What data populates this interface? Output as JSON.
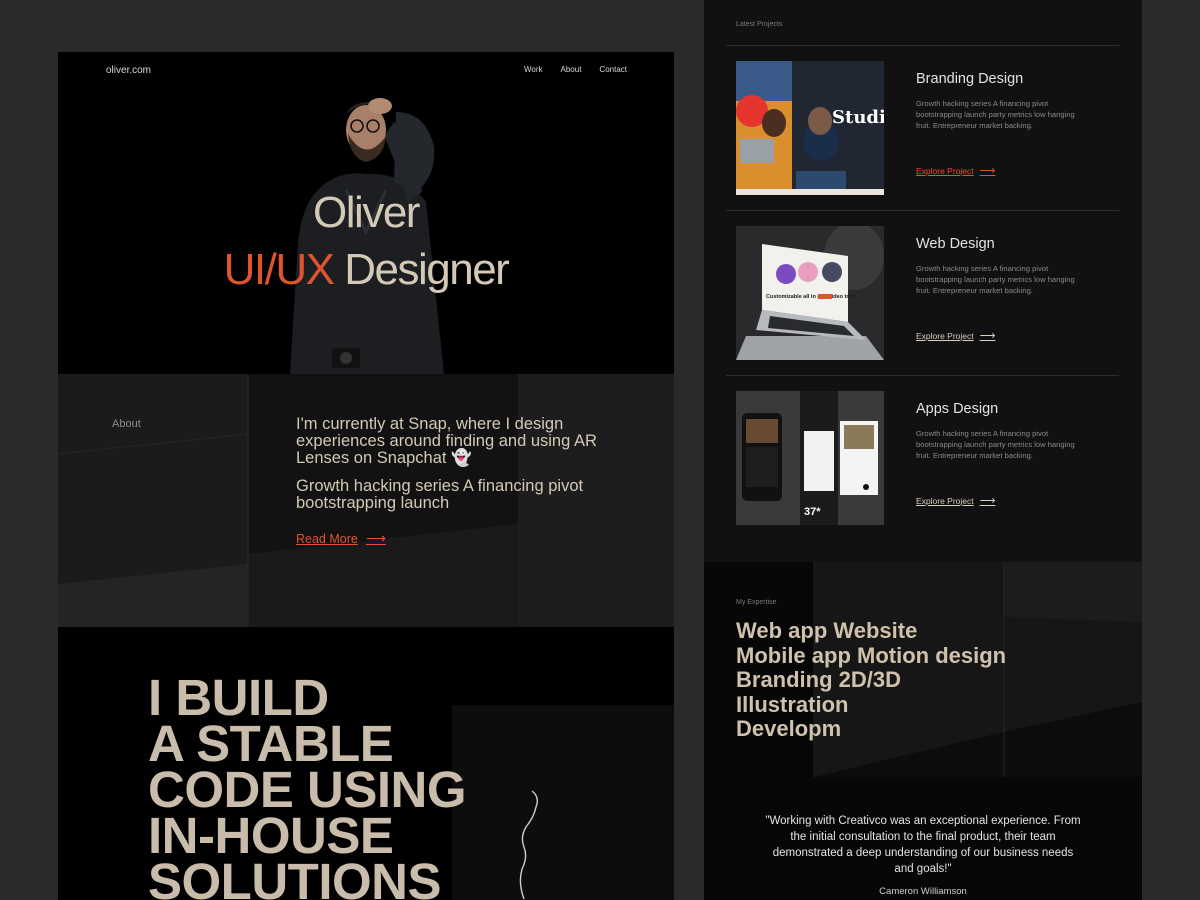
{
  "left": {
    "logo": "oliver.com",
    "nav": {
      "work": "Work",
      "about": "About",
      "contact": "Contact"
    },
    "hero": {
      "name": "Oliver",
      "role_accent": "UI/UX",
      "role_rest": " Designer"
    },
    "about": {
      "label": "About",
      "paragraph1": "I'm currently at Snap, where I design experiences around finding and using AR Lenses on Snapchat 👻",
      "paragraph2": "Growth hacking series A financing pivot bootstrapping launch",
      "read_more": "Read More"
    },
    "build": {
      "lines": [
        "I BUILD",
        "A STABLE",
        "CODE USING",
        "IN-HOUSE",
        "SOLUTIONS"
      ]
    }
  },
  "right": {
    "latest_label": "Latest Projects",
    "projects": [
      {
        "title": "Branding Design",
        "description": "Growth hacking series A financing pivot bootstrapping launch party metrics low hanging fruit. Entrepreneur market backing.",
        "link": "Explore Project"
      },
      {
        "title": "Web Design",
        "description": "Growth hacking series A financing pivot bootstrapping launch party metrics low hanging fruit. Entrepreneur market backing.",
        "link": "Explore Project"
      },
      {
        "title": "Apps Design",
        "description": "Growth hacking series A financing pivot bootstrapping launch party metrics low hanging fruit. Entrepreneur market backing.",
        "link": "Explore Project"
      }
    ],
    "thumb_text": {
      "studio": "Studio",
      "laptop_caption": "Customizable all in one video tool",
      "app_price": "37*"
    },
    "expertise": {
      "label": "My Expertise",
      "lines": [
        "Web app Website",
        "Mobile app Motion design",
        "Branding 2D/3D",
        "Illustration",
        "Developm"
      ]
    },
    "testimonial": {
      "quote": "\"Working with Creativco was an exceptional experience. From the initial consultation to the final product, their team demonstrated a deep understanding of our business needs and goals!\"",
      "author": "Cameron Williamson"
    }
  },
  "colors": {
    "accent": "#e0532f",
    "beige": "#d4c9b6",
    "background": "#2a2a2a"
  }
}
